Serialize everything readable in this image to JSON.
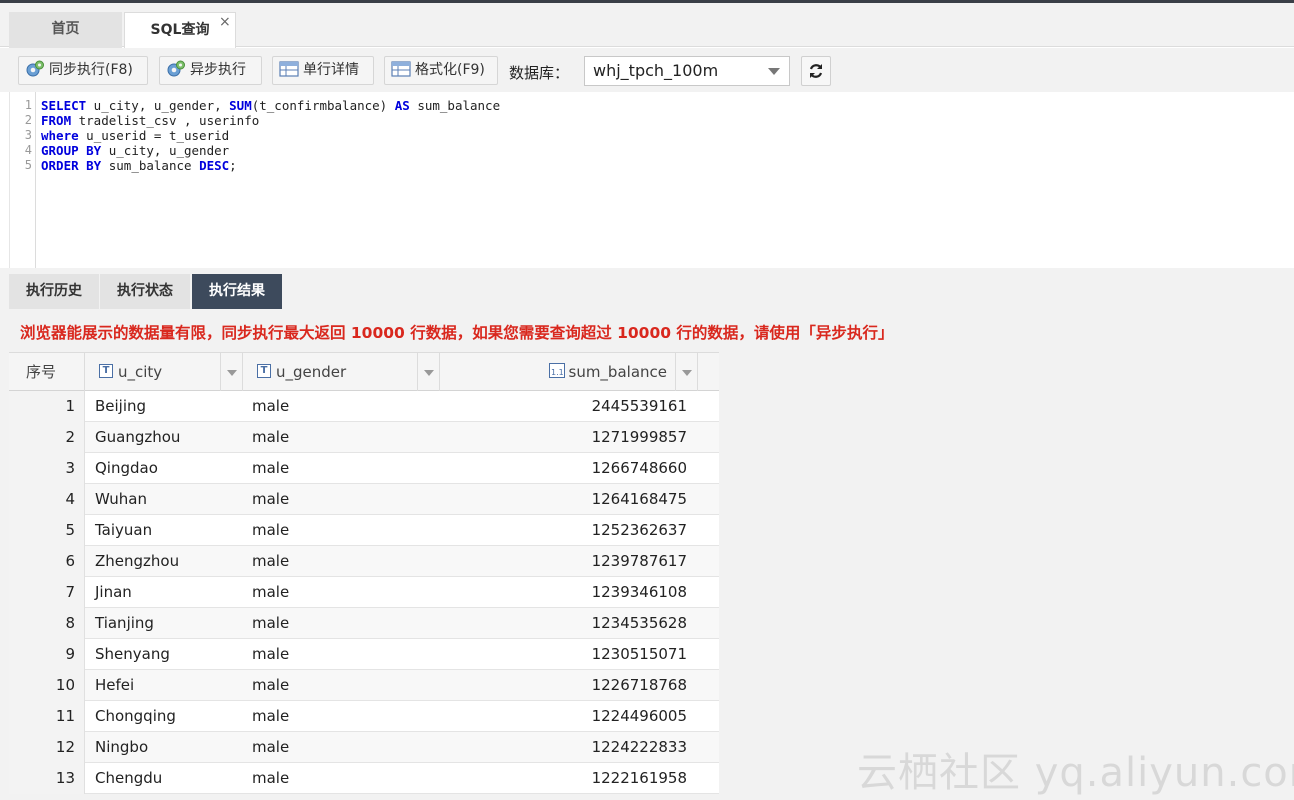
{
  "tabs": [
    {
      "label": "首页"
    },
    {
      "label": "SQL查询"
    }
  ],
  "tab_close": "×",
  "toolbar": {
    "sync_exec": "同步执行(F8)",
    "async_exec": "异步执行",
    "row_detail": "单行详情",
    "format": "格式化(F9)",
    "db_label": "数据库：",
    "db_value": "whj_tpch_100m"
  },
  "editor": {
    "line_numbers": [
      "1",
      "2",
      "3",
      "4",
      "5"
    ]
  },
  "result_tabs": [
    "执行历史",
    "执行状态",
    "执行结果"
  ],
  "warning": "浏览器能展示的数据量有限，同步执行最大返回 10000 行数据，如果您需要查询超过 10000 行的数据，请使用「异步执行」",
  "grid": {
    "headers": [
      "序号",
      "u_city",
      "u_gender",
      "sum_balance"
    ],
    "rows": [
      {
        "n": "1",
        "city": "Beijing",
        "gender": "male",
        "bal": "2445539161"
      },
      {
        "n": "2",
        "city": "Guangzhou",
        "gender": "male",
        "bal": "1271999857"
      },
      {
        "n": "3",
        "city": "Qingdao",
        "gender": "male",
        "bal": "1266748660"
      },
      {
        "n": "4",
        "city": "Wuhan",
        "gender": "male",
        "bal": "1264168475"
      },
      {
        "n": "5",
        "city": "Taiyuan",
        "gender": "male",
        "bal": "1252362637"
      },
      {
        "n": "6",
        "city": "Zhengzhou",
        "gender": "male",
        "bal": "1239787617"
      },
      {
        "n": "7",
        "city": "Jinan",
        "gender": "male",
        "bal": "1239346108"
      },
      {
        "n": "8",
        "city": "Tianjing",
        "gender": "male",
        "bal": "1234535628"
      },
      {
        "n": "9",
        "city": "Shenyang",
        "gender": "male",
        "bal": "1230515071"
      },
      {
        "n": "10",
        "city": "Hefei",
        "gender": "male",
        "bal": "1226718768"
      },
      {
        "n": "11",
        "city": "Chongqing",
        "gender": "male",
        "bal": "1224496005"
      },
      {
        "n": "12",
        "city": "Ningbo",
        "gender": "male",
        "bal": "1224222833"
      },
      {
        "n": "13",
        "city": "Chengdu",
        "gender": "male",
        "bal": "1222161958"
      }
    ]
  },
  "watermark": "云栖社区 yq.aliyun.com",
  "colors": {
    "accent_tab": "#3d4a5c",
    "warning": "#d9281e",
    "keyword": "#0000dd"
  }
}
